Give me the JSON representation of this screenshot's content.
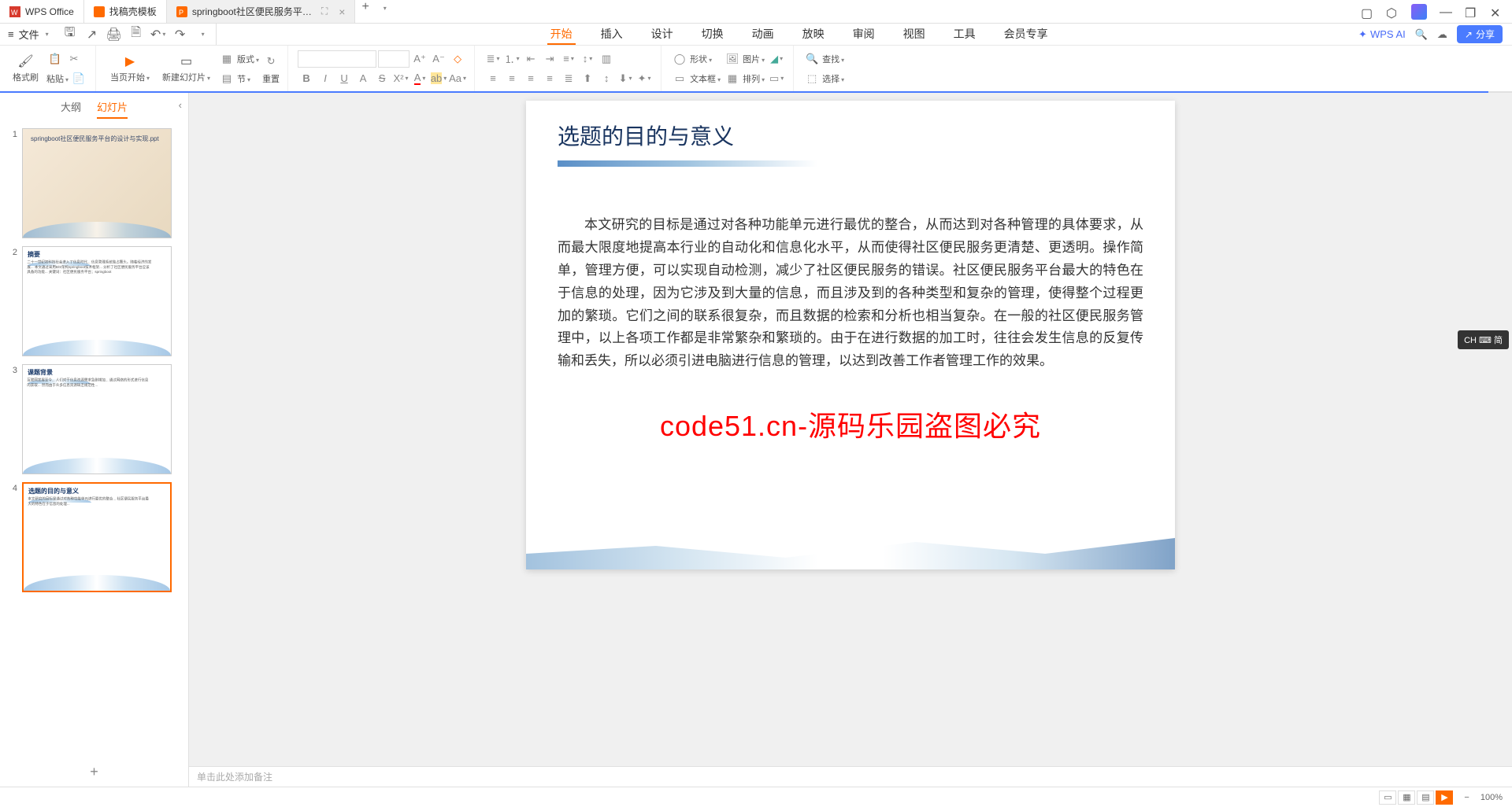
{
  "titleBar": {
    "tab1": "WPS Office",
    "tab2": "找稿壳模板",
    "tab3": "springboot社区便民服务平…"
  },
  "fileMenu": "文件",
  "mainMenu": {
    "start": "开始",
    "insert": "插入",
    "design": "设计",
    "transition": "切换",
    "animation": "动画",
    "slideshow": "放映",
    "review": "审阅",
    "view": "视图",
    "tools": "工具",
    "member": "会员专享"
  },
  "menuRight": {
    "wpsai": "WPS AI",
    "share": "分享"
  },
  "ribbon": {
    "formatBrush": "格式刷",
    "paste": "粘贴",
    "startFromCurrent": "当页开始",
    "newSlide": "新建幻灯片",
    "layout": "版式",
    "section": "节",
    "reset": "重置",
    "shape": "形状",
    "picture": "图片",
    "find": "查找",
    "textbox": "文本框",
    "arrange": "排列",
    "select": "选择"
  },
  "sideTabs": {
    "outline": "大纲",
    "slides": "幻灯片"
  },
  "thumbs": [
    {
      "num": "1",
      "title": "springboot社区便民服务平台的设计与实现.ppt"
    },
    {
      "num": "2",
      "title": "摘要"
    },
    {
      "num": "3",
      "title": "课题背景"
    },
    {
      "num": "4",
      "title": "选题的目的与意义"
    }
  ],
  "slide": {
    "title": "选题的目的与意义",
    "body": "本文研究的目标是通过对各种功能单元进行最优的整合，从而达到对各种管理的具体要求，从而最大限度地提高本行业的自动化和信息化水平，从而使得社区便民服务更清楚、更透明。操作简单，管理方便，可以实现自动检测，减少了社区便民服务的错误。社区便民服务平台最大的特色在于信息的处理，因为它涉及到大量的信息，而且涉及到的各种类型和复杂的管理，使得整个过程更加的繁琐。它们之间的联系很复杂，而且数据的检索和分析也相当复杂。在一般的社区便民服务管理中，以上各项工作都是非常繁杂和繁琐的。由于在进行数据的加工时，往往会发生信息的反复传输和丢失，所以必须引进电脑进行信息的管理，以达到改善工作者管理工作的效果。"
  },
  "watermark": "code51.cn-源码乐园盗图必究",
  "notes": "单击此处添加备注",
  "ime": "CH ⌨ 简",
  "status": {
    "zoom": "100%"
  }
}
